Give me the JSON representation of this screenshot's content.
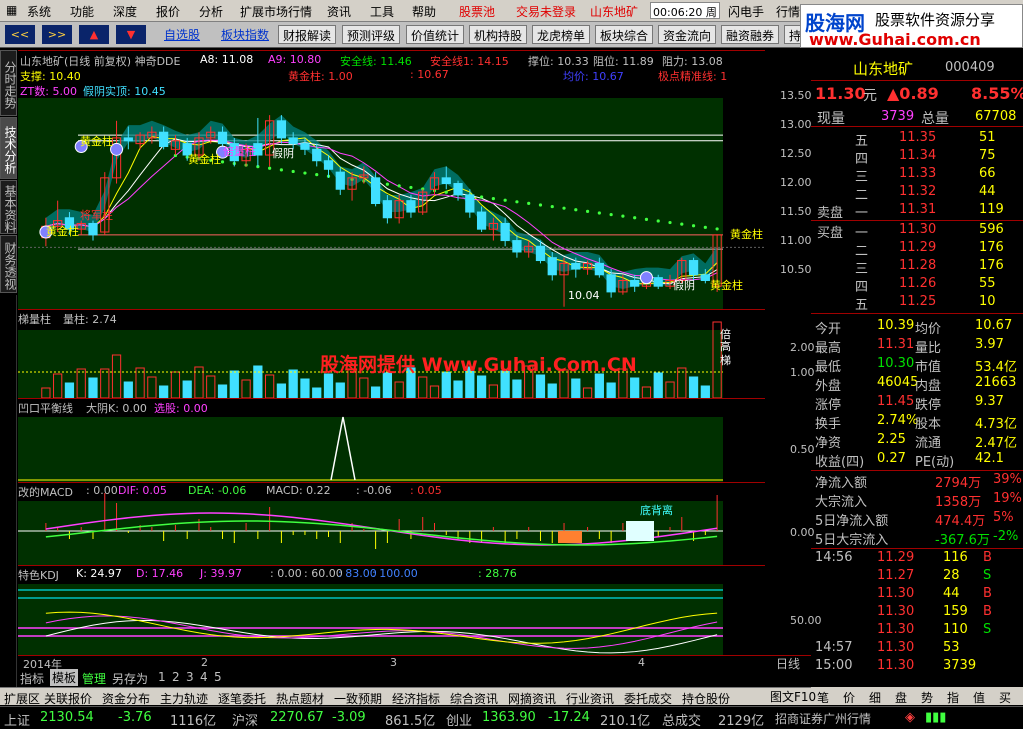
{
  "menu": [
    "系统",
    "功能",
    "深度",
    "报价",
    "分析",
    "扩展市场行情",
    "资讯",
    "工具",
    "帮助"
  ],
  "menu_red": [
    "股票池",
    "交易未登录",
    "山东地矿"
  ],
  "clock": "00:06:20 周六",
  "menu_right": [
    "闪电手",
    "行情"
  ],
  "toolbar": {
    "nav": [
      "<<",
      ">>",
      "▲",
      "▼"
    ],
    "links": [
      "自选股",
      "板块指数"
    ],
    "buttons": [
      "财报解读",
      "预测评级",
      "价值统计",
      "机构持股",
      "龙虎榜单",
      "板块综合",
      "资金流向",
      "融资融券",
      "持"
    ]
  },
  "side_tabs": [
    "分时走势",
    "技术分析",
    "基本资料",
    "财务透视"
  ],
  "main_panel": {
    "title": "山东地矿(日线 前复权) 神奇DDE",
    "a8": "A8: 11.08",
    "a9": "A9: 10.80",
    "safe": "安全线: 11.46",
    "safe1": "安全线1: 14.15",
    "zhang": "撑位: 10.33",
    "zu": "阻位: 11.89",
    "zuli": "阻力: 13.08",
    "zhicheng": "支撑: 10.40",
    "huangjin": "黄金柱: 1.00",
    "v10_67": ": 10.67",
    "junjia": "均价: 10.67",
    "jixian": "极点精准线: 1",
    "zt": "ZT数: 5.00",
    "jiayin": "假阴实顶: 10.45"
  },
  "annotations": {
    "huangjinzhu": "黄金柱",
    "jiangjunzhu": "将军柱",
    "jiayin": "假阴",
    "beiliang": "倍量柱",
    "low": "10.04"
  },
  "price_axis": [
    "13.50",
    "13.00",
    "12.50",
    "12.00",
    "11.50",
    "11.00",
    "10.50"
  ],
  "panel2": {
    "title": "梯量柱",
    "sub": "量柱: 2.74",
    "axis": [
      "2.00",
      "1.00"
    ],
    "labels": [
      "倍",
      "高",
      "梯"
    ]
  },
  "panel3": {
    "title": "凹口平衡线",
    "k": "大阴K: 0.00",
    "xuan": "选股: 0.00",
    "axis": "0.50"
  },
  "panel4": {
    "title": "改的MACD",
    "vals": ": 0.00",
    "dif": "DIF: 0.05",
    "dea": "DEA: -0.06",
    "macd": "MACD: 0.22",
    "v2": ": -0.06",
    "v3": ": 0.05",
    "label": "底背离",
    "axis": "0.00"
  },
  "panel5": {
    "title": "特色KDJ",
    "k": "K: 24.97",
    "d": "D: 17.46",
    "j": "J: 39.97",
    "v0": ": 0.00",
    "v60": ": 60.00",
    "v83": ": 83.00",
    "v100": ": 100.00",
    "v28": ": 28.76",
    "axis": "50.00"
  },
  "dates": [
    "2014年",
    "2",
    "3",
    "4"
  ],
  "bottom_bar": [
    "指标",
    "模板",
    "管理",
    "另存为",
    "1",
    "2",
    "3",
    "4",
    "5"
  ],
  "period": "日线",
  "watermark": "股海网提供 Www.Guhai.Com.CN",
  "logo": {
    "title": "股海网",
    "sub": "股票软件资源分享",
    "url": "www.Guhai.com.cn"
  },
  "stock": {
    "name": "山东地矿",
    "code": "000409",
    "price": "11.30",
    "unit": "元",
    "change": "▲0.89",
    "pct": "8.55%",
    "xianliang_l": "现量",
    "xianliang": "3739",
    "zongliang_l": "总量",
    "zongliang": "67708"
  },
  "asks": [
    {
      "l": "五",
      "p": "11.35",
      "v": "51"
    },
    {
      "l": "四",
      "p": "11.34",
      "v": "75"
    },
    {
      "l": "三",
      "p": "11.33",
      "v": "66"
    },
    {
      "l": "二",
      "p": "11.32",
      "v": "44"
    },
    {
      "l": "一",
      "p": "11.31",
      "v": "119"
    }
  ],
  "ask_title": "卖盘",
  "bid_title": "买盘",
  "bids": [
    {
      "l": "一",
      "p": "11.30",
      "v": "596"
    },
    {
      "l": "二",
      "p": "11.29",
      "v": "176"
    },
    {
      "l": "三",
      "p": "11.28",
      "v": "176"
    },
    {
      "l": "四",
      "p": "11.26",
      "v": "55"
    },
    {
      "l": "五",
      "p": "11.25",
      "v": "10"
    }
  ],
  "stats": [
    [
      "今开",
      "10.39",
      "均价",
      "10.67"
    ],
    [
      "最高",
      "11.31",
      "量比",
      "3.97"
    ],
    [
      "最低",
      "10.30",
      "市值",
      "53.4亿"
    ],
    [
      "外盘",
      "46045",
      "内盘",
      "21663"
    ],
    [
      "涨停",
      "11.45",
      "跌停",
      "9.37"
    ],
    [
      "换手",
      "2.74%",
      "股本",
      "4.73亿"
    ],
    [
      "净资",
      "2.25",
      "流通",
      "2.47亿"
    ],
    [
      "收益(四)",
      "0.27",
      "PE(动)",
      "42.1"
    ]
  ],
  "flows": [
    [
      "净流入额",
      "2794万",
      "39%"
    ],
    [
      "大宗流入",
      "1358万",
      "19%"
    ],
    [
      "5日净流入额",
      "474.4万",
      "5%"
    ],
    [
      "5日大宗流入",
      "-367.6万",
      "-2%"
    ]
  ],
  "ticks": [
    [
      "14:56",
      "11.29",
      "116",
      "B"
    ],
    [
      "",
      "11.27",
      "28",
      "S"
    ],
    [
      "",
      "11.30",
      "44",
      "B"
    ],
    [
      "",
      "11.30",
      "159",
      "B"
    ],
    [
      "",
      "11.30",
      "110",
      "S"
    ],
    [
      "14:57",
      "11.30",
      "53",
      ""
    ],
    [
      "15:00",
      "11.30",
      "3739",
      ""
    ]
  ],
  "right_tabs": [
    "笔",
    "价",
    "细",
    "盘",
    "势",
    "指",
    "值",
    "买"
  ],
  "bottom_tabs": [
    "扩展区",
    "关联报价",
    "资金分布",
    "主力轨迹",
    "逐笔委托",
    "热点题材",
    "一致预期",
    "经济指标",
    "综合资讯",
    "网摘资讯",
    "行业资讯",
    "委托成交",
    "持仓股份"
  ],
  "bottom_right": [
    "图文F10"
  ],
  "status": {
    "sh_l": "上证",
    "sh": "2130.54",
    "sh_c": "-3.76",
    "sh_v": "1116亿",
    "hs_l": "沪深",
    "hs": "2270.67",
    "hs_c": "-3.09",
    "hs_v": "861.5亿",
    "cy_l": "创业",
    "cy": "1363.90",
    "cy_c": "-17.24",
    "cy_v": "210.1亿",
    "tot_l": "总成交",
    "tot": "2129亿",
    "broker": "招商证券广州行情"
  },
  "colors": {
    "red": "#ff3030",
    "green": "#00e000",
    "cyan": "#40e0ff",
    "yellow": "#ffff00",
    "magenta": "#ff40ff",
    "blue": "#4080ff"
  },
  "chart_data": {
    "type": "candlestick",
    "ylim": [
      10.0,
      13.7
    ],
    "candles": [
      [
        11.25,
        11.6,
        11.1,
        11.45
      ],
      [
        11.45,
        11.9,
        11.35,
        11.55
      ],
      [
        11.6,
        11.7,
        11.3,
        11.4
      ],
      [
        11.4,
        11.55,
        11.3,
        11.5
      ],
      [
        11.5,
        11.55,
        11.2,
        11.3
      ],
      [
        11.35,
        12.4,
        11.3,
        12.3
      ],
      [
        12.3,
        13.3,
        12.2,
        13.0
      ],
      [
        13.0,
        13.2,
        12.8,
        12.95
      ],
      [
        12.9,
        13.1,
        12.8,
        13.05
      ],
      [
        13.0,
        13.2,
        12.9,
        13.1
      ],
      [
        13.1,
        13.2,
        12.8,
        12.85
      ],
      [
        12.8,
        13.05,
        12.7,
        12.95
      ],
      [
        12.9,
        13.0,
        12.6,
        12.7
      ],
      [
        12.7,
        13.1,
        12.6,
        13.0
      ],
      [
        13.0,
        13.2,
        12.9,
        13.1
      ],
      [
        13.1,
        13.2,
        12.85,
        12.9
      ],
      [
        12.9,
        13.0,
        12.5,
        12.6
      ],
      [
        12.6,
        12.9,
        12.5,
        12.8
      ],
      [
        12.9,
        13.35,
        12.5,
        12.7
      ],
      [
        12.7,
        13.4,
        12.5,
        13.3
      ],
      [
        13.3,
        13.4,
        12.9,
        13.0
      ],
      [
        13.0,
        13.1,
        12.8,
        12.9
      ],
      [
        12.9,
        13.0,
        12.7,
        12.8
      ],
      [
        12.8,
        12.9,
        12.5,
        12.6
      ],
      [
        12.6,
        12.7,
        12.3,
        12.45
      ],
      [
        12.4,
        12.5,
        12.0,
        12.1
      ],
      [
        12.1,
        12.4,
        11.9,
        12.3
      ],
      [
        12.3,
        12.5,
        12.2,
        12.35
      ],
      [
        12.3,
        12.4,
        11.8,
        11.85
      ],
      [
        11.9,
        12.0,
        11.5,
        11.6
      ],
      [
        11.6,
        12.0,
        11.5,
        11.9
      ],
      [
        11.9,
        12.0,
        11.6,
        11.7
      ],
      [
        11.7,
        12.1,
        11.65,
        12.05
      ],
      [
        12.1,
        12.4,
        12.0,
        12.3
      ],
      [
        12.3,
        12.5,
        12.1,
        12.2
      ],
      [
        12.2,
        12.25,
        11.9,
        12.0
      ],
      [
        12.0,
        12.1,
        11.6,
        11.7
      ],
      [
        11.7,
        11.8,
        11.35,
        11.4
      ],
      [
        11.4,
        11.6,
        11.2,
        11.5
      ],
      [
        11.5,
        11.6,
        11.1,
        11.2
      ],
      [
        11.2,
        11.3,
        10.9,
        11.0
      ],
      [
        11.0,
        11.2,
        10.9,
        11.1
      ],
      [
        11.1,
        11.2,
        10.8,
        10.85
      ],
      [
        10.9,
        11.0,
        10.5,
        10.6
      ],
      [
        10.6,
        10.9,
        10.04,
        10.8
      ],
      [
        10.8,
        10.9,
        10.55,
        10.7
      ],
      [
        10.7,
        10.85,
        10.6,
        10.8
      ],
      [
        10.8,
        10.9,
        10.55,
        10.6
      ],
      [
        10.6,
        10.7,
        10.2,
        10.3
      ],
      [
        10.3,
        10.6,
        10.25,
        10.5
      ],
      [
        10.5,
        10.6,
        10.3,
        10.4
      ],
      [
        10.4,
        10.65,
        10.35,
        10.55
      ],
      [
        10.55,
        10.6,
        10.35,
        10.4
      ],
      [
        10.4,
        10.6,
        10.35,
        10.5
      ],
      [
        10.5,
        10.9,
        10.45,
        10.85
      ],
      [
        10.85,
        10.9,
        10.5,
        10.6
      ],
      [
        10.6,
        10.7,
        10.45,
        10.5
      ],
      [
        10.4,
        11.31,
        10.3,
        11.3
      ]
    ]
  }
}
